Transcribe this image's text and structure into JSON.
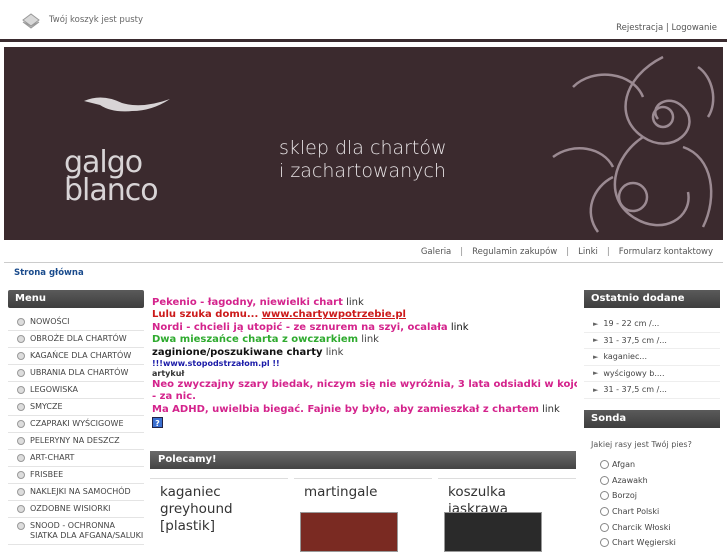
{
  "header": {
    "cart_text": "Twój koszyk jest pusty",
    "register": "Rejestracja",
    "separator": "|",
    "login": "Logowanie"
  },
  "banner": {
    "logo_top": "galgo",
    "logo_bottom": "blanco",
    "tagline_1": "sklep dla chartów",
    "tagline_2": "i zachartowanych",
    "bg_color": "#3b2a2e"
  },
  "nav": [
    "Galeria",
    "Regulamin zakupów",
    "Linki",
    "Formularz kontaktowy"
  ],
  "breadcrumb": "Strona główna",
  "menu": {
    "title": "Menu",
    "items": [
      "NOWOŚCI",
      "OBROŻE DLA CHARTÓW",
      "KAGAŃCE DLA CHARTÓW",
      "UBRANIA DLA CHARTÓW",
      "LEGOWISKA",
      "SMYCZE",
      "CZAPRAKI WYŚCIGOWE",
      "PELERYNY NA DESZCZ",
      "ART-CHART",
      "FRISBEE",
      "NAKLEJKI NA SAMOCHÓD",
      "OZDOBNE WISIORKI",
      "SNOOD - OCHRONNA SIATKA DLA AFGANA/SALUKI"
    ]
  },
  "content": {
    "lines": [
      {
        "text": "Pekenio - łagodny, niewielki chart",
        "color": "#d4238c",
        "link": "link"
      },
      {
        "text": "Lulu szuka domu... ",
        "color": "#cc1a1a",
        "url": "www.chartywpotrzebie.pl"
      },
      {
        "text": "Nordi - chcieli ją utopić - ze sznurem na szyi, ocalała",
        "color": "#d4238c",
        "link": "link"
      },
      {
        "text": "Dwa mieszańce charta z owczarkiem",
        "color": "#2eaa2e",
        "link": "link"
      },
      {
        "text": "zaginione/poszukiwane charty",
        "color": "#111111",
        "link": "link"
      },
      {
        "text": "!!!www.stopodstrzałom.pl !!",
        "color": "#1a1aa8"
      },
      {
        "text": "artykuł",
        "color": "#333333"
      },
      {
        "text": "Neo zwyczajny szary biedak, niczym się nie wyróżnia, 3 lata odsiadki w kojcu",
        "color": "#d4238c",
        "link": "link"
      },
      {
        "text": "- za nic.",
        "color": "#d4238c"
      },
      {
        "text": "Ma ADHD, uwielbia biegać. Fajnie by było, aby zamieszkał z chartem",
        "color": "#d4238c",
        "link": "link"
      }
    ]
  },
  "polecamy": {
    "title": "Polecamy!",
    "products": [
      "kaganiec greyhound [plastik]",
      "martingale",
      "koszulka jaskrawa"
    ]
  },
  "recent": {
    "title": "Ostatnio dodane",
    "items": [
      "19 - 22 cm /...",
      "31 - 37,5 cm /...",
      "kaganiec...",
      "wyścigowy b....",
      "31 - 37,5 cm /..."
    ]
  },
  "poll": {
    "title": "Sonda",
    "question": "Jakiej rasy jest Twój pies?",
    "options": [
      "Afgan",
      "Azawakh",
      "Borzoj",
      "Chart Polski",
      "Charcik Włoski",
      "Chart Węgierski"
    ]
  }
}
